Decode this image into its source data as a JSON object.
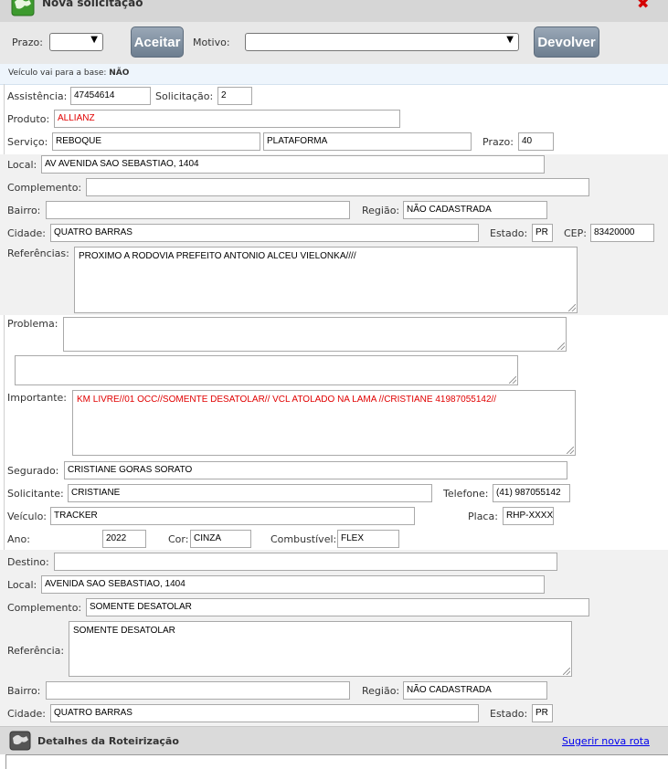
{
  "window": {
    "title": "Nova solicitação",
    "close_icon": "close-icon"
  },
  "toolbar": {
    "prazo_label": "Prazo:",
    "prazo_value": "",
    "aceitar_label": "Aceitar",
    "motivo_label": "Motivo:",
    "motivo_value": "",
    "devolver_label": "Devolver"
  },
  "info": {
    "base_label": "Veículo vai para a base:",
    "base_value": "NÃO"
  },
  "request": {
    "assistencia_label": "Assistência:",
    "assistencia": "47454614",
    "solicitacao_label": "Solicitação:",
    "solicitacao": "2",
    "produto_label": "Produto:",
    "produto": "ALLIANZ",
    "servico_label": "Serviço:",
    "servico": "REBOQUE",
    "servico_tipo": "PLATAFORMA",
    "prazo_label": "Prazo:",
    "prazo": "40"
  },
  "origin": {
    "local_label": "Local:",
    "local": "AV AVENIDA SAO SEBASTIAO, 1404",
    "complemento_label": "Complemento:",
    "complemento": "",
    "bairro_label": "Bairro:",
    "bairro": "",
    "regiao_label": "Região:",
    "regiao": "NÃO CADASTRADA",
    "cidade_label": "Cidade:",
    "cidade": "QUATRO BARRAS",
    "estado_label": "Estado:",
    "estado": "PR",
    "cep_label": "CEP:",
    "cep": "83420000",
    "referencias_label": "Referências:",
    "referencias": "PROXIMO A RODOVIA PREFEITO ANTONIO ALCEU VIELONKA////"
  },
  "problem": {
    "problema_label": "Problema:",
    "problema": "",
    "extra": "",
    "importante_label": "Importante:",
    "importante": "KM LIVRE//01 OCC//SOMENTE DESATOLAR// VCL ATOLADO NA LAMA  //CRISTIANE 41987055142//"
  },
  "vehicle": {
    "segurado_label": "Segurado:",
    "segurado": "CRISTIANE GORAS SORATO",
    "solicitante_label": "Solicitante:",
    "solicitante": "CRISTIANE",
    "telefone_label": "Telefone:",
    "telefone": "(41) 987055142",
    "veiculo_label": "Veículo:",
    "veiculo": "TRACKER",
    "placa_label": "Placa:",
    "placa": "RHP-XXXX",
    "ano_label": "Ano:",
    "ano": "2022",
    "cor_label": "Cor:",
    "cor": "CINZA",
    "combustivel_label": "Combustível:",
    "combustivel": "FLEX"
  },
  "destination": {
    "destino_label": "Destino:",
    "destino": "",
    "local_label": "Local:",
    "local": "AVENIDA SAO SEBASTIAO, 1404",
    "complemento_label": "Complemento:",
    "complemento": "SOMENTE DESATOLAR",
    "referencia_label": "Referência:",
    "referencia": "SOMENTE DESATOLAR",
    "bairro_label": "Bairro:",
    "bairro": "",
    "regiao_label": "Região:",
    "regiao": "NÃO CADASTRADA",
    "cidade_label": "Cidade:",
    "cidade": "QUATRO BARRAS",
    "estado_label": "Estado:",
    "estado": "PR"
  },
  "footer": {
    "title": "Detalhes da Roteirização",
    "link": "Sugerir nova rota"
  },
  "colors": {
    "required_text": "#e00000",
    "button": "#7b8b9c",
    "band": "#f1f1f1",
    "info_bg": "#eef5fc"
  }
}
